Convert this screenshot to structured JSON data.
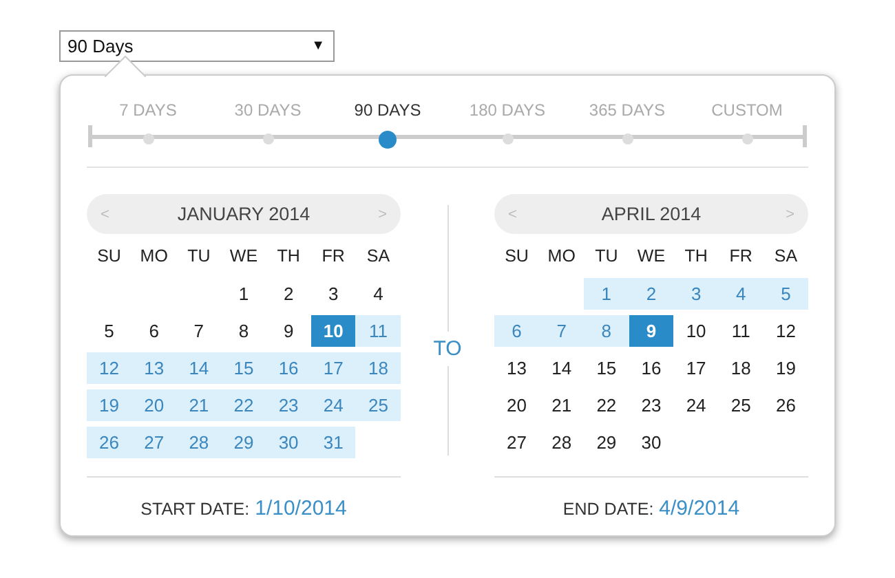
{
  "range_select": {
    "value": "90 Days",
    "caret": "▼"
  },
  "presets": [
    {
      "label": "7 DAYS",
      "selected": false
    },
    {
      "label": "30 DAYS",
      "selected": false
    },
    {
      "label": "90 DAYS",
      "selected": true
    },
    {
      "label": "180 DAYS",
      "selected": false
    },
    {
      "label": "365 DAYS",
      "selected": false
    },
    {
      "label": "CUSTOM",
      "selected": false
    }
  ],
  "calendars": [
    {
      "month": "JANUARY 2014",
      "prev": "<",
      "next": ">",
      "weekdays": [
        "SU",
        "MO",
        "TU",
        "WE",
        "TH",
        "FR",
        "SA"
      ],
      "days": [
        {
          "kind": "blank"
        },
        {
          "kind": "blank"
        },
        {
          "kind": "blank"
        },
        {
          "kind": "day",
          "text": "1",
          "in_range": false,
          "selected": false
        },
        {
          "kind": "day",
          "text": "2",
          "in_range": false,
          "selected": false
        },
        {
          "kind": "day",
          "text": "3",
          "in_range": false,
          "selected": false
        },
        {
          "kind": "day",
          "text": "4",
          "in_range": false,
          "selected": false
        },
        {
          "kind": "day",
          "text": "5",
          "in_range": false,
          "selected": false
        },
        {
          "kind": "day",
          "text": "6",
          "in_range": false,
          "selected": false
        },
        {
          "kind": "day",
          "text": "7",
          "in_range": false,
          "selected": false
        },
        {
          "kind": "day",
          "text": "8",
          "in_range": false,
          "selected": false
        },
        {
          "kind": "day",
          "text": "9",
          "in_range": false,
          "selected": false
        },
        {
          "kind": "day",
          "text": "10",
          "in_range": false,
          "selected": true
        },
        {
          "kind": "day",
          "text": "11",
          "in_range": true,
          "selected": false
        },
        {
          "kind": "day",
          "text": "12",
          "in_range": true,
          "selected": false
        },
        {
          "kind": "day",
          "text": "13",
          "in_range": true,
          "selected": false
        },
        {
          "kind": "day",
          "text": "14",
          "in_range": true,
          "selected": false
        },
        {
          "kind": "day",
          "text": "15",
          "in_range": true,
          "selected": false
        },
        {
          "kind": "day",
          "text": "16",
          "in_range": true,
          "selected": false
        },
        {
          "kind": "day",
          "text": "17",
          "in_range": true,
          "selected": false
        },
        {
          "kind": "day",
          "text": "18",
          "in_range": true,
          "selected": false
        },
        {
          "kind": "day",
          "text": "19",
          "in_range": true,
          "selected": false
        },
        {
          "kind": "day",
          "text": "20",
          "in_range": true,
          "selected": false
        },
        {
          "kind": "day",
          "text": "21",
          "in_range": true,
          "selected": false
        },
        {
          "kind": "day",
          "text": "22",
          "in_range": true,
          "selected": false
        },
        {
          "kind": "day",
          "text": "23",
          "in_range": true,
          "selected": false
        },
        {
          "kind": "day",
          "text": "24",
          "in_range": true,
          "selected": false
        },
        {
          "kind": "day",
          "text": "25",
          "in_range": true,
          "selected": false
        },
        {
          "kind": "day",
          "text": "26",
          "in_range": true,
          "selected": false
        },
        {
          "kind": "day",
          "text": "27",
          "in_range": true,
          "selected": false
        },
        {
          "kind": "day",
          "text": "28",
          "in_range": true,
          "selected": false
        },
        {
          "kind": "day",
          "text": "29",
          "in_range": true,
          "selected": false
        },
        {
          "kind": "day",
          "text": "30",
          "in_range": true,
          "selected": false
        },
        {
          "kind": "day",
          "text": "31",
          "in_range": true,
          "selected": false
        }
      ],
      "date_label": "START DATE:",
      "date_value": "1/10/2014"
    },
    {
      "month": "APRIL 2014",
      "prev": "<",
      "next": ">",
      "weekdays": [
        "SU",
        "MO",
        "TU",
        "WE",
        "TH",
        "FR",
        "SA"
      ],
      "days": [
        {
          "kind": "blank"
        },
        {
          "kind": "blank"
        },
        {
          "kind": "day",
          "text": "1",
          "in_range": true,
          "selected": false
        },
        {
          "kind": "day",
          "text": "2",
          "in_range": true,
          "selected": false
        },
        {
          "kind": "day",
          "text": "3",
          "in_range": true,
          "selected": false
        },
        {
          "kind": "day",
          "text": "4",
          "in_range": true,
          "selected": false
        },
        {
          "kind": "day",
          "text": "5",
          "in_range": true,
          "selected": false
        },
        {
          "kind": "day",
          "text": "6",
          "in_range": true,
          "selected": false
        },
        {
          "kind": "day",
          "text": "7",
          "in_range": true,
          "selected": false
        },
        {
          "kind": "day",
          "text": "8",
          "in_range": true,
          "selected": false
        },
        {
          "kind": "day",
          "text": "9",
          "in_range": false,
          "selected": true
        },
        {
          "kind": "day",
          "text": "10",
          "in_range": false,
          "selected": false
        },
        {
          "kind": "day",
          "text": "11",
          "in_range": false,
          "selected": false
        },
        {
          "kind": "day",
          "text": "12",
          "in_range": false,
          "selected": false
        },
        {
          "kind": "day",
          "text": "13",
          "in_range": false,
          "selected": false
        },
        {
          "kind": "day",
          "text": "14",
          "in_range": false,
          "selected": false
        },
        {
          "kind": "day",
          "text": "15",
          "in_range": false,
          "selected": false
        },
        {
          "kind": "day",
          "text": "16",
          "in_range": false,
          "selected": false
        },
        {
          "kind": "day",
          "text": "17",
          "in_range": false,
          "selected": false
        },
        {
          "kind": "day",
          "text": "18",
          "in_range": false,
          "selected": false
        },
        {
          "kind": "day",
          "text": "19",
          "in_range": false,
          "selected": false
        },
        {
          "kind": "day",
          "text": "20",
          "in_range": false,
          "selected": false
        },
        {
          "kind": "day",
          "text": "21",
          "in_range": false,
          "selected": false
        },
        {
          "kind": "day",
          "text": "22",
          "in_range": false,
          "selected": false
        },
        {
          "kind": "day",
          "text": "23",
          "in_range": false,
          "selected": false
        },
        {
          "kind": "day",
          "text": "24",
          "in_range": false,
          "selected": false
        },
        {
          "kind": "day",
          "text": "25",
          "in_range": false,
          "selected": false
        },
        {
          "kind": "day",
          "text": "26",
          "in_range": false,
          "selected": false
        },
        {
          "kind": "day",
          "text": "27",
          "in_range": false,
          "selected": false
        },
        {
          "kind": "day",
          "text": "28",
          "in_range": false,
          "selected": false
        },
        {
          "kind": "day",
          "text": "29",
          "in_range": false,
          "selected": false
        },
        {
          "kind": "day",
          "text": "30",
          "in_range": false,
          "selected": false
        }
      ],
      "date_label": "END DATE:",
      "date_value": "4/9/2014"
    }
  ],
  "separator": "TO"
}
